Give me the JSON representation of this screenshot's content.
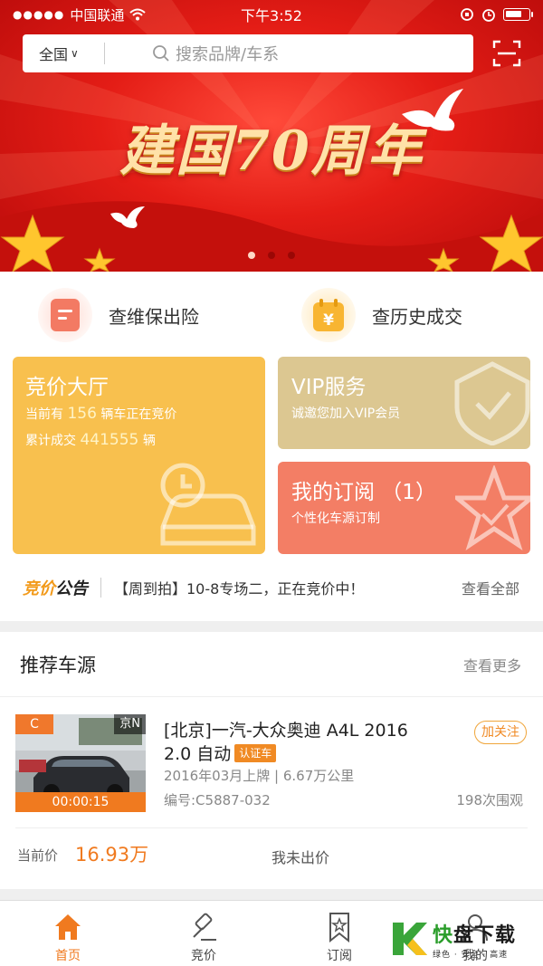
{
  "status_bar": {
    "carrier": "中国联通",
    "time": "下午3:52",
    "battery_level": 0.75
  },
  "search": {
    "region": "全国",
    "placeholder": "搜索品牌/车系"
  },
  "banner": {
    "title": "建国70周年",
    "slide_count": 3,
    "active_slide": 1
  },
  "quick_links": [
    {
      "label": "查维保出险",
      "icon": "document-icon"
    },
    {
      "label": "查历史成交",
      "icon": "calendar-yen-icon"
    }
  ],
  "auction_hall": {
    "title": "竞价大厅",
    "line1_prefix": "当前有",
    "line1_count": "156",
    "line1_suffix": "辆车正在竞价",
    "line2_prefix": "累计成交",
    "line2_count": "441555",
    "line2_suffix": "辆",
    "color": "#f8c04e"
  },
  "vip": {
    "title": "VIP服务",
    "subtitle": "诚邀您加入VIP会员",
    "color": "#dcc791"
  },
  "subscription": {
    "title": "我的订阅 （1）",
    "subtitle": "个性化车源订制",
    "color": "#f37e65"
  },
  "notice": {
    "logo_a": "竞价",
    "logo_b": "公告",
    "text": "【周到拍】10-8专场二，正在竞价中！",
    "view_all": "查看全部"
  },
  "recommend": {
    "title": "推荐车源",
    "more": "查看更多",
    "car": {
      "grade": "C",
      "plate": "京N",
      "timer": "00:00:15",
      "title_line1": "[北京]一汽-大众奥迪 A4L 2016",
      "title_line2": "2.0 自动",
      "cert": "认证车",
      "follow": "加关注",
      "meta": "2016年03月上牌 | 6.67万公里",
      "code": "编号:C5887-032",
      "views": "198次围观",
      "price_label": "当前价",
      "price": "16.93万",
      "bid_status": "我未出价"
    }
  },
  "tabbar": [
    {
      "label": "首页",
      "icon": "home-icon",
      "active": true
    },
    {
      "label": "竞价",
      "icon": "gavel-icon",
      "active": false
    },
    {
      "label": "订阅",
      "icon": "bookmark-star-icon",
      "active": false
    },
    {
      "label": "我的",
      "icon": "user-icon",
      "active": false
    }
  ],
  "watermark": {
    "brand_a": "快",
    "brand_b": "盘下载",
    "slogan": "绿色 · 安全 · 高速"
  },
  "colors": {
    "accent": "#f07a1f",
    "banner_red": "#e41d16"
  }
}
